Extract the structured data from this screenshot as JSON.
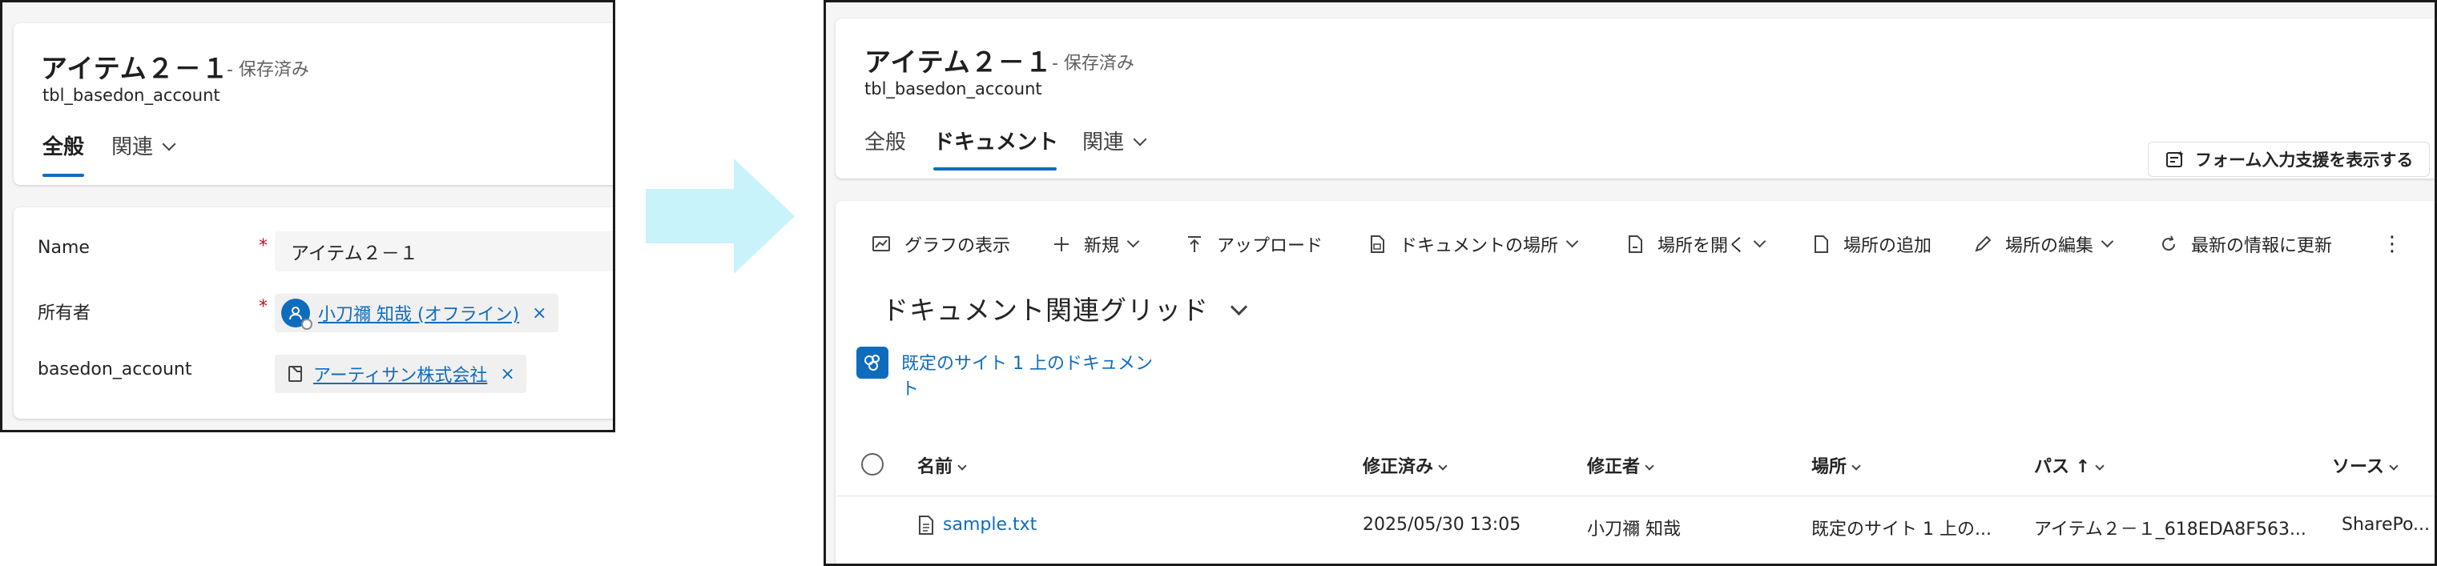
{
  "left_form": {
    "record_title": "アイテム２－１",
    "save_status": "- 保存済み",
    "entity_name": "tbl_basedon_account",
    "tabs": [
      {
        "label": "全般",
        "selected": true
      },
      {
        "label": "関連",
        "selected": false,
        "has_dropdown": true
      }
    ],
    "fields": {
      "name": {
        "label": "Name",
        "required_mark": "*",
        "value": "アイテム２－１"
      },
      "owner": {
        "label": "所有者",
        "required_mark": "*",
        "value": "小刀禰 知哉 (オフライン)",
        "remove": "×",
        "icon": "person-icon"
      },
      "basedon_account": {
        "label": "basedon_account",
        "value": "アーティサン株式会社",
        "remove": "×",
        "icon": "account-icon"
      }
    }
  },
  "right_form": {
    "record_title": "アイテム２－１",
    "save_status": "- 保存済み",
    "entity_name": "tbl_basedon_account",
    "tabs": [
      {
        "label": "全般",
        "selected": false
      },
      {
        "label": "ドキュメント",
        "selected": true
      },
      {
        "label": "関連",
        "selected": false,
        "has_dropdown": true
      }
    ],
    "form_assist_button": "フォーム入力支援を表示する",
    "command_bar": {
      "show_chart": "グラフの表示",
      "new": "新規",
      "upload": "アップロード",
      "document_location": "ドキュメントの場所",
      "open_location": "場所を開く",
      "add_location": "場所の追加",
      "edit_location": "場所の編集",
      "refresh": "最新の情報に更新",
      "more": "⋮"
    },
    "grid": {
      "view_title": "ドキュメント関連グリッド",
      "site_link": "既定のサイト 1 上のドキュメン\nト",
      "columns": [
        {
          "label": "名前",
          "sort": "chevron"
        },
        {
          "label": "修正済み",
          "sort": "chevron"
        },
        {
          "label": "修正者",
          "sort": "chevron"
        },
        {
          "label": "場所",
          "sort": "chevron"
        },
        {
          "label": "パス ↑",
          "sort": "chevron"
        },
        {
          "label": "ソース",
          "sort": "chevron"
        }
      ],
      "rows": [
        {
          "name": "sample.txt",
          "modified": "2025/05/30 13:05",
          "modified_by": "小刀禰 知哉",
          "location": "既定のサイト 1 上の...",
          "path": "アイテム２－１_618EDA8F563...",
          "source": "SharePo..."
        }
      ]
    }
  },
  "colors": {
    "accent": "#0f6cbd",
    "arrow": "#c8f3fa",
    "required": "#c50f1f",
    "panel_bg": "#f5f5f5"
  }
}
